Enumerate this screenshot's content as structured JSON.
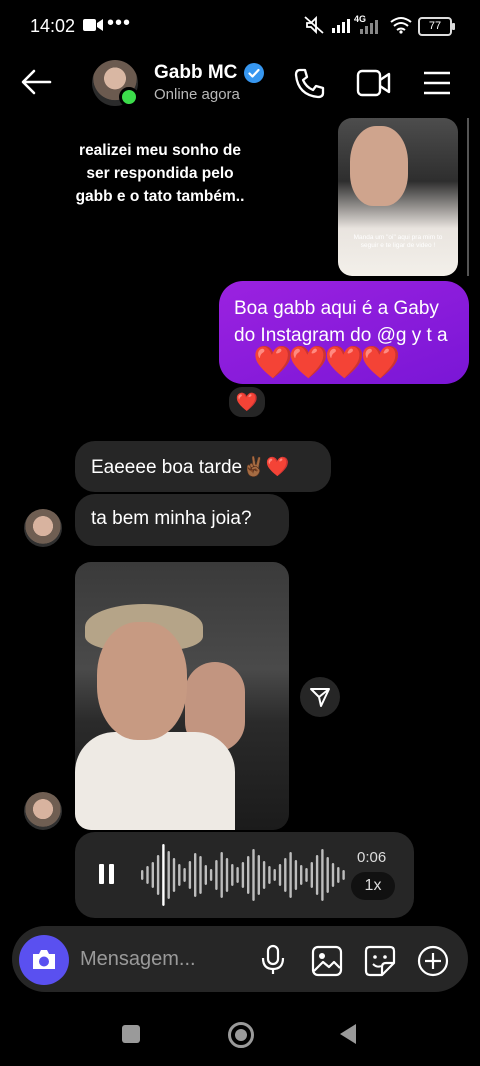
{
  "status_bar": {
    "time": "14:02",
    "dots": "•••",
    "network": "4G",
    "battery": "77"
  },
  "header": {
    "contact_name": "Gabb MC",
    "status": "Online agora"
  },
  "messages": {
    "story_reply_caption": "realizei meu sonho de ser respondida pelo gabb e o tato também..",
    "story_overlay_text": "Manda um \"oi\" aqui pra mim to seguir e te ligar de video !",
    "sent_text": "Boa gabb aqui é a Gaby do Instagram do @g y t a",
    "sent_hearts": "❤️❤️❤️❤️",
    "reaction": "❤️",
    "received_1": "Eaeeee boa tarde✌🏾❤️",
    "received_2": "ta bem minha joia?",
    "voice_duration": "0:06",
    "voice_speed": "1x"
  },
  "composer": {
    "placeholder": "Mensagem..."
  },
  "colors": {
    "sent_bubble": "#8b1ee0",
    "received_bubble": "#262626",
    "camera_button": "#5a50f0",
    "online": "#3cdc4b",
    "verified": "#3797f0"
  }
}
